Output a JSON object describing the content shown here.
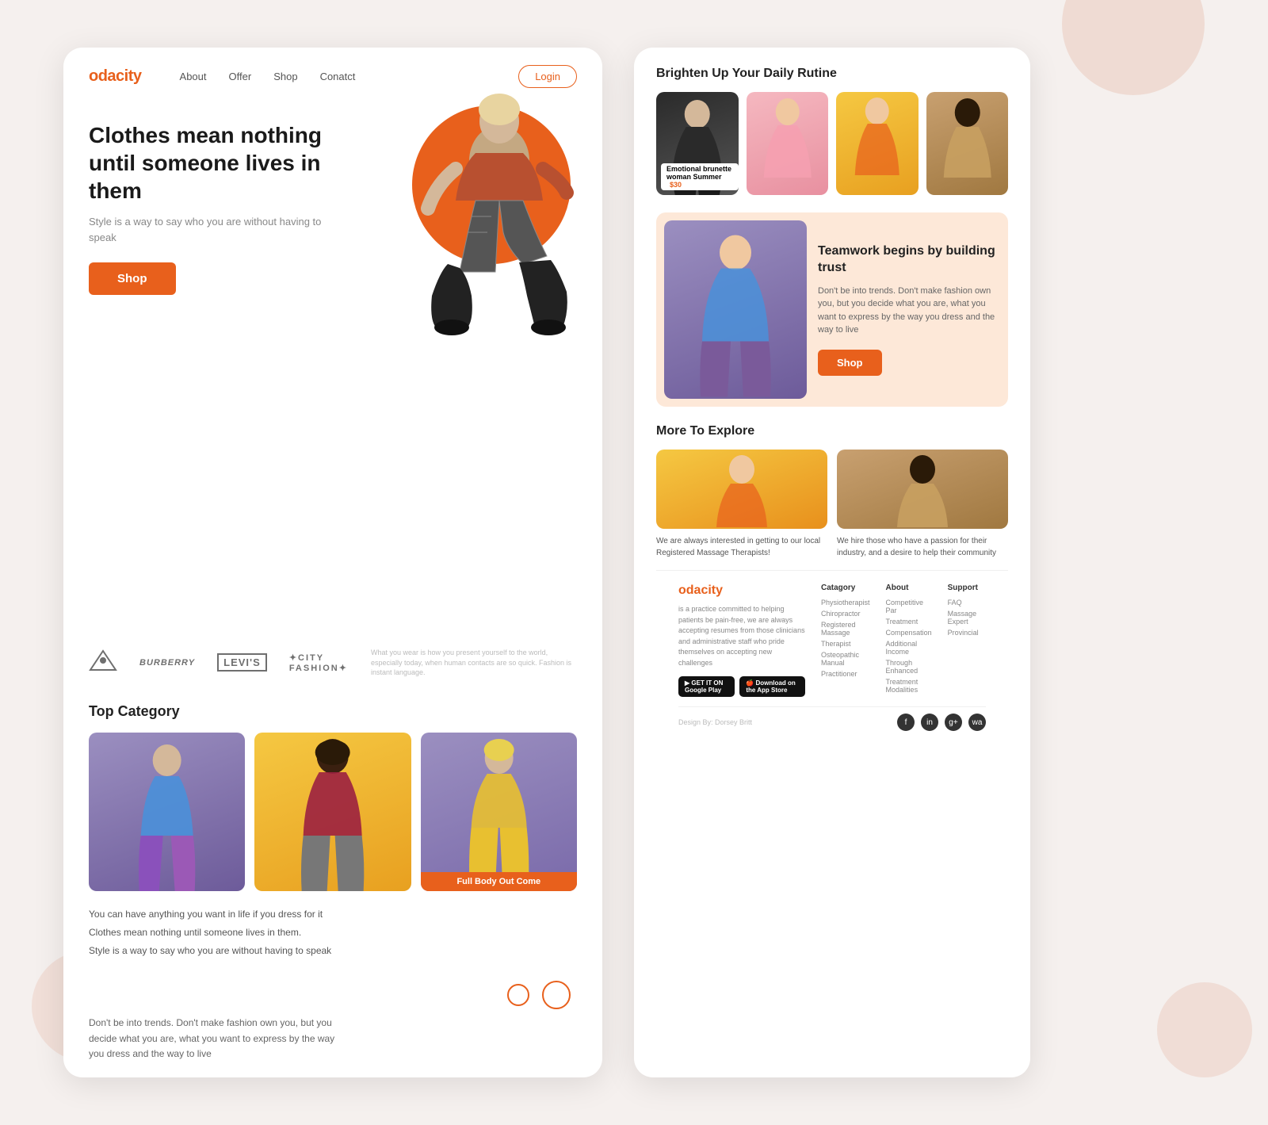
{
  "background": {
    "accent_color": "#e8601c"
  },
  "left_page": {
    "nav": {
      "logo": "odacity",
      "logo_accent": "o",
      "links": [
        "About",
        "Offer",
        "Shop",
        "Conatct"
      ],
      "login_label": "Login"
    },
    "hero": {
      "title": "Clothes mean nothing until someone lives in them",
      "subtitle": "Style is a way to say who you are without having to speak",
      "shop_btn": "Shop"
    },
    "brands": [
      "Versace",
      "BURBERRY",
      "LEVI'S",
      "CITY FASHION"
    ],
    "brand_tagline": "What you wear is how you present yourself to the world, especially today, when human contacts are so quick. Fashion is instant language.",
    "top_category": {
      "title": "Top Category",
      "cards": [
        {
          "label": ""
        },
        {
          "label": ""
        },
        {
          "label": "Full Body Out Come"
        }
      ]
    },
    "bottom_lines": [
      "You can have anything you want in life if you dress for it",
      "Clothes mean nothing until someone lives in them.",
      "Style is a way to say who you are without having to speak"
    ],
    "quote": "Don't be into trends. Don't make fashion own you, but you decide what you are, what you want to express by the way you dress and the way to live"
  },
  "right_page": {
    "brighten_section": {
      "heading": "Brighten Up Your Daily Rutine",
      "cards": [
        {
          "price": "$30",
          "label": "Emotional brunette woman Summer"
        },
        {
          "price": ""
        },
        {
          "price": ""
        },
        {
          "price": ""
        }
      ]
    },
    "teamwork": {
      "title": "Teamwork begins by building trust",
      "desc": "Don't be into trends. Don't make fashion own you, but you decide what you are, what you want to express by the way you dress and the way to live",
      "btn": "Shop"
    },
    "explore": {
      "heading": "More To Explore",
      "cards": [
        {
          "desc": "We are always interested in getting to our local Registered Massage Therapists!"
        },
        {
          "desc": "We hire those who have a passion for their industry, and a desire to help their community"
        }
      ]
    },
    "footer": {
      "logo": "odacity",
      "logo_accent": "o",
      "desc": "is a practice committed to helping patients be pain-free, we are always accepting resumes from those clinicians and administrative staff who pride themselves on accepting new challenges",
      "google_play": "GET IT ON Google Play",
      "app_store": "Download on the App Store",
      "columns": [
        {
          "title": "Catagory",
          "items": [
            "Physiotherapist",
            "Chiropractor",
            "Registered Massage",
            "Therapist",
            "Osteopathic Manual",
            "Practitioner"
          ]
        },
        {
          "title": "About",
          "items": [
            "Competitive Par",
            "Treatment",
            "Compensation",
            "Additional Income",
            "Through Enhanced",
            "Treatment Modalities"
          ]
        },
        {
          "title": "Support",
          "items": [
            "FAQ",
            "Massage Expert",
            "Provincial"
          ]
        }
      ],
      "copyright": "Design By: Dorsey Britt",
      "social": [
        "f",
        "in",
        "g+",
        "wa"
      ]
    }
  }
}
